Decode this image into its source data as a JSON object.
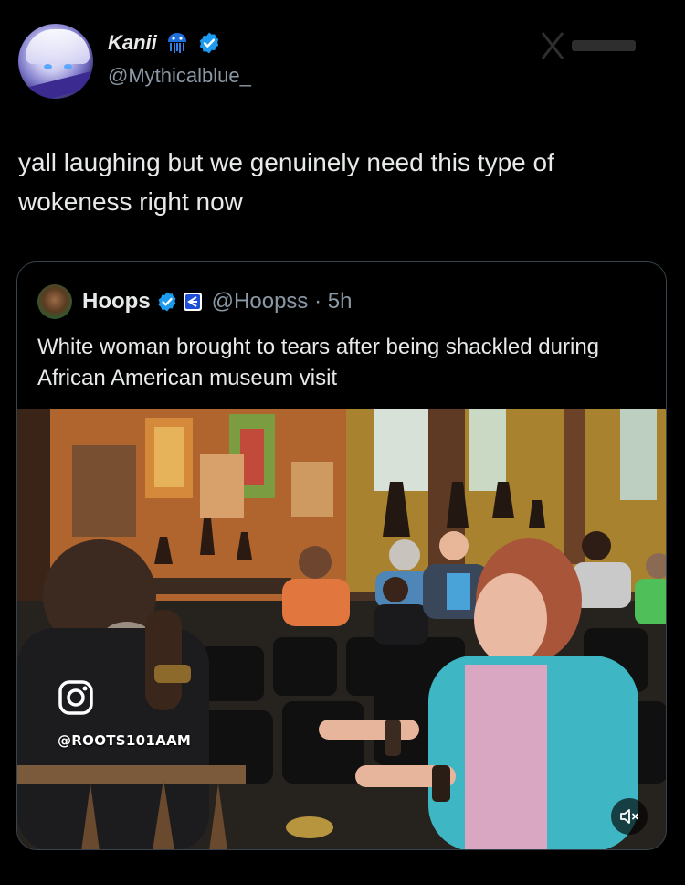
{
  "tweet": {
    "author_name": "Kanii",
    "author_handle": "@Mythicalblue_",
    "text": "yall laughing but we genuinely need this type of wokeness right now"
  },
  "quoted_tweet": {
    "author_name": "Hoops",
    "author_handle": "@Hoopss",
    "separator": "·",
    "time": "5h",
    "text": "White woman brought to tears after being shackled during African American museum visit"
  },
  "media": {
    "watermark_handle": "@ROOTS101AAM",
    "watermark_icon": "instagram-icon",
    "mute_icon": "speaker-muted-icon"
  },
  "colors": {
    "background": "#000000",
    "text_primary": "#e7e9ea",
    "text_secondary": "#8b98a5",
    "verified_blue": "#1d9bf0",
    "border": "#38444d"
  }
}
